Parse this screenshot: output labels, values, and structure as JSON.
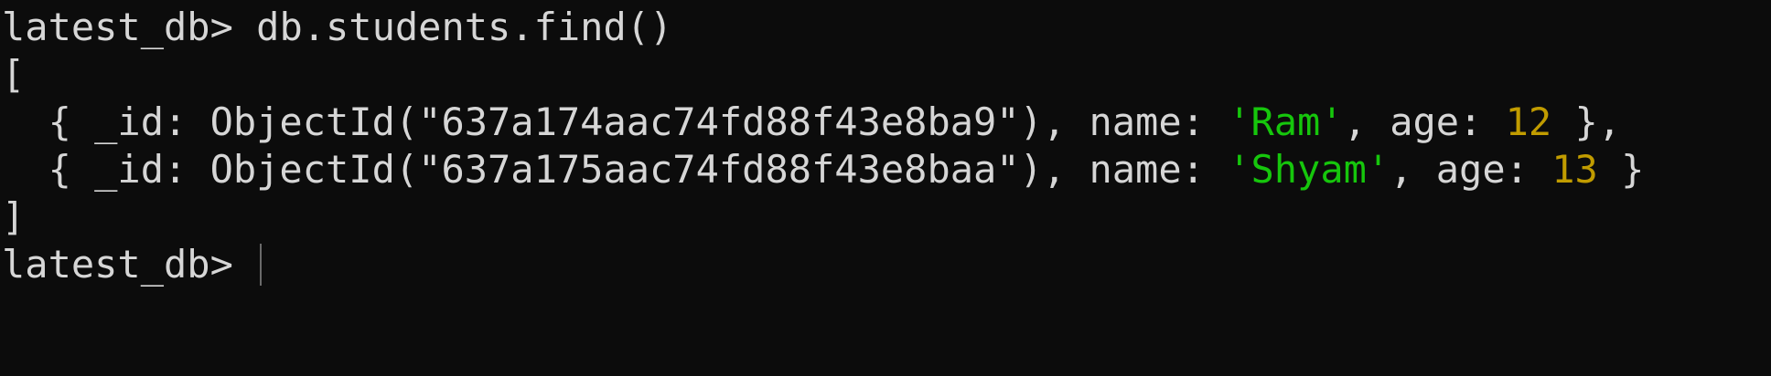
{
  "terminal": {
    "prompt": "latest_db> ",
    "command": "db.students.find()",
    "open_bracket": "[",
    "close_bracket": "]",
    "records": [
      {
        "prefix": "  { _id: ",
        "object_id": "ObjectId(\"637a174aac74fd88f43e8ba9\")",
        "name_label": ", name: ",
        "name": "'Ram'",
        "age_label": ", age: ",
        "age": "12",
        "suffix": " },"
      },
      {
        "prefix": "  { _id: ",
        "object_id": "ObjectId(\"637a175aac74fd88f43e8baa\")",
        "name_label": ", name: ",
        "name": "'Shyam'",
        "age_label": ", age: ",
        "age": "13",
        "suffix": " }"
      }
    ]
  },
  "colors": {
    "background": "#0c0c0c",
    "text": "#d6d6d6",
    "string": "#16c60c",
    "number": "#c19c00"
  }
}
